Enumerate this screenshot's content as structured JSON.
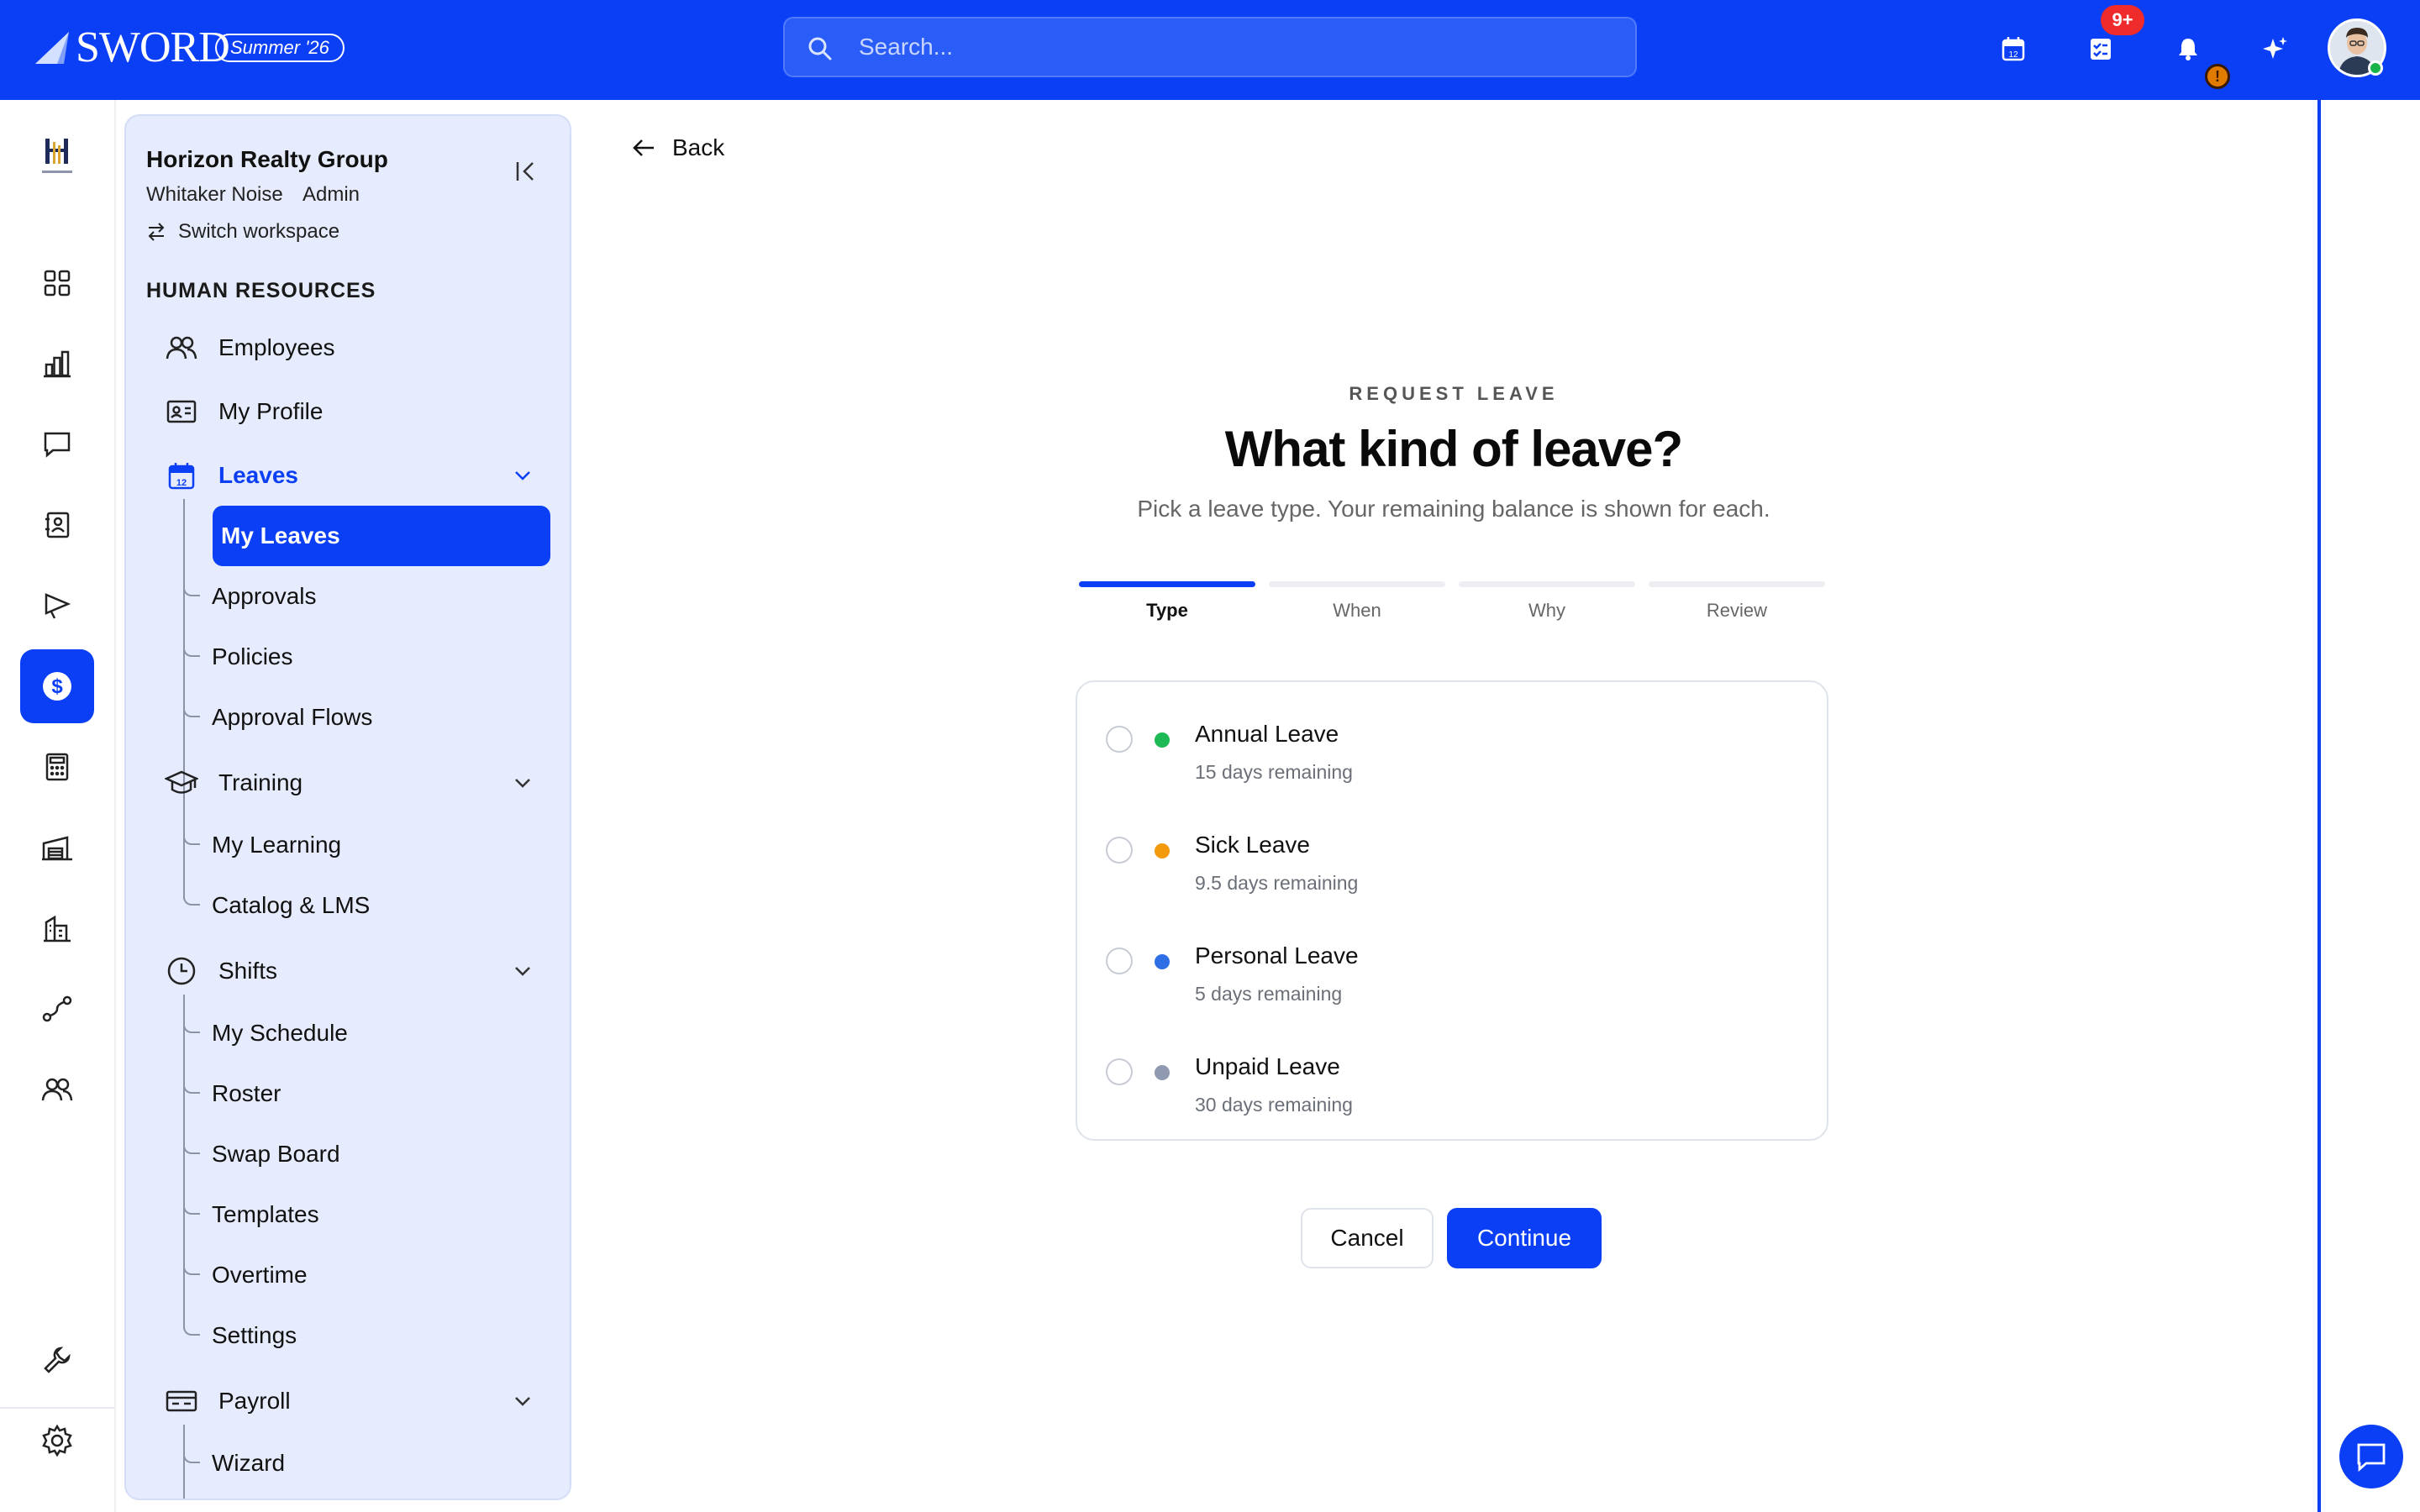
{
  "app": {
    "logo_text": "SWORD",
    "season_label": "Summer '26",
    "brand_colors": {
      "primary": "#0b3ff5",
      "sidebar_bg": "#e6ecfd"
    }
  },
  "search": {
    "placeholder": "Search..."
  },
  "header": {
    "tasks_badge": "9+",
    "warning_badge": "!",
    "icons": [
      "calendar-icon",
      "tasks-icon",
      "bell-icon",
      "sparkle-icon"
    ]
  },
  "workspace": {
    "name": "Horizon Realty Group",
    "user": "Whitaker Noise",
    "role": "Admin",
    "switch_label": "Switch workspace",
    "section": "HUMAN RESOURCES"
  },
  "nav": {
    "employees": "Employees",
    "my_profile": "My Profile",
    "leaves": {
      "label": "Leaves",
      "items": [
        "My Leaves",
        "Approvals",
        "Policies",
        "Approval Flows"
      ]
    },
    "training": {
      "label": "Training",
      "items": [
        "My Learning",
        "Catalog & LMS"
      ]
    },
    "shifts": {
      "label": "Shifts",
      "items": [
        "My Schedule",
        "Roster",
        "Swap Board",
        "Templates",
        "Overtime",
        "Settings"
      ]
    },
    "payroll": {
      "label": "Payroll",
      "items": [
        "Wizard"
      ]
    }
  },
  "main": {
    "back_label": "Back",
    "eyebrow": "REQUEST LEAVE",
    "title": "What kind of leave?",
    "subtitle": "Pick a leave type. Your remaining balance is shown for each.",
    "steps": [
      "Type",
      "When",
      "Why",
      "Review"
    ],
    "current_step": 0,
    "leave_types": [
      {
        "name": "Annual Leave",
        "remaining": "15 days remaining",
        "color": "#1db954"
      },
      {
        "name": "Sick Leave",
        "remaining": "9.5 days remaining",
        "color": "#f29a0c"
      },
      {
        "name": "Personal Leave",
        "remaining": "5 days remaining",
        "color": "#2f6fe6"
      },
      {
        "name": "Unpaid Leave",
        "remaining": "30 days remaining",
        "color": "#8f9ab0"
      }
    ],
    "cancel_label": "Cancel",
    "continue_label": "Continue"
  }
}
